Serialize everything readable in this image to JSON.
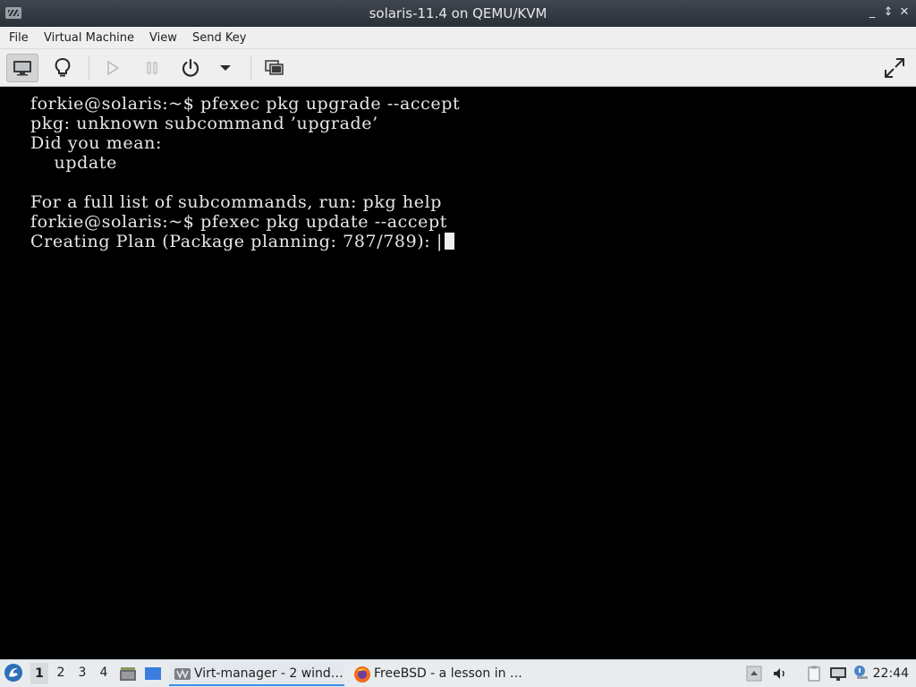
{
  "window": {
    "title": "solaris-11.4 on QEMU/KVM",
    "minimize_label": "_",
    "maximize_label": "↕",
    "close_label": "✕"
  },
  "menu": [
    "File",
    "Virtual Machine",
    "View",
    "Send Key"
  ],
  "toolbar": {
    "icons": [
      "console-icon",
      "details-bulb-icon",
      "run-icon",
      "pause-icon",
      "power-icon",
      "dropdown-arrow-icon",
      "snapshots-icon",
      "fullscreen-icon"
    ]
  },
  "console": {
    "lines": [
      "forkie@solaris:~$ pfexec pkg upgrade --accept",
      "pkg: unknown subcommand ’upgrade’",
      "Did you mean:",
      "    update",
      "",
      "For a full list of subcommands, run: pkg help",
      "forkie@solaris:~$ pfexec pkg update --accept",
      "Creating Plan (Package planning: 787/789): |"
    ]
  },
  "taskbar": {
    "workspaces": [
      "1",
      "2",
      "3",
      "4"
    ],
    "active_workspace": "1",
    "tasks": [
      {
        "label": "Virt-manager - 2 wind…",
        "icon": "virt-manager-icon"
      },
      {
        "label": "FreeBSD - a lesson in …",
        "icon": "firefox-icon"
      }
    ],
    "clock": "22:44"
  },
  "colors": {
    "titlebar": "#2f353d",
    "menubar": "#efefef",
    "console_bg": "#000000",
    "console_fg": "#e8e8e8",
    "taskbar": "#e9ecef",
    "accent": "#3a8ee6"
  }
}
